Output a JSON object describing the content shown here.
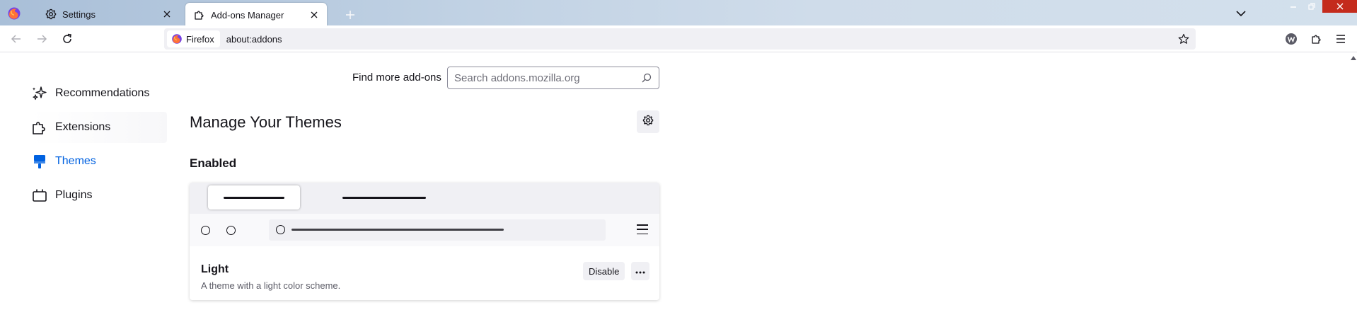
{
  "browser": {
    "tabs": [
      {
        "title": "Settings",
        "icon": "gear-icon",
        "active": false
      },
      {
        "title": "Add-ons Manager",
        "icon": "puzzle-icon",
        "active": true
      }
    ],
    "identity_label": "Firefox",
    "url": "about:addons",
    "colors": {
      "accent": "#0061e0",
      "close_button": "#c42b1c"
    }
  },
  "addons": {
    "find_more_label": "Find more add-ons",
    "search_placeholder": "Search addons.mozilla.org",
    "sidebar": [
      {
        "label": "Recommendations",
        "icon": "recommendations-icon"
      },
      {
        "label": "Extensions",
        "icon": "extensions-icon"
      },
      {
        "label": "Themes",
        "icon": "themes-icon",
        "selected": true
      },
      {
        "label": "Plugins",
        "icon": "plugins-icon"
      }
    ],
    "page_title": "Manage Your Themes",
    "section_heading": "Enabled",
    "theme": {
      "name": "Light",
      "description": "A theme with a light color scheme.",
      "disable_label": "Disable"
    }
  }
}
